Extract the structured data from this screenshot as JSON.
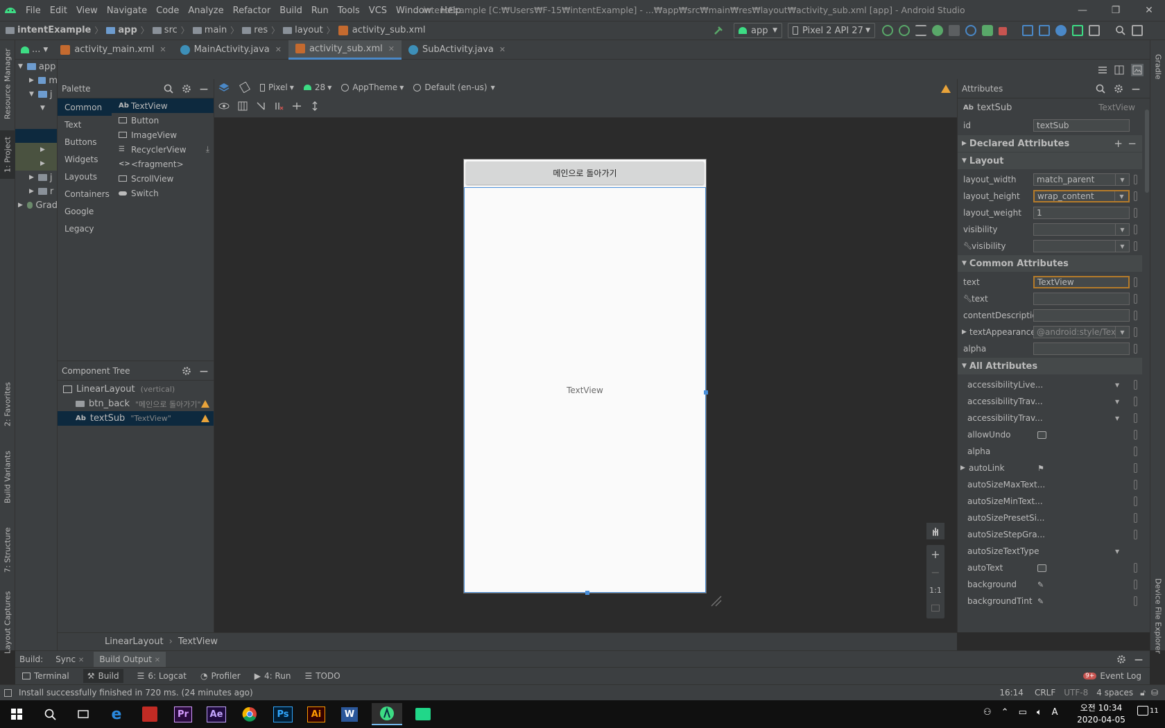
{
  "menubar": {
    "items": [
      "File",
      "Edit",
      "View",
      "Navigate",
      "Code",
      "Analyze",
      "Refactor",
      "Build",
      "Run",
      "Tools",
      "VCS",
      "Window",
      "Help"
    ],
    "title": "intentExample [C:₩Users₩F-15₩intentExample] - ...₩app₩src₩main₩res₩layout₩activity_sub.xml [app] - Android Studio",
    "minimize": "—",
    "restore": "❐",
    "close": "✕"
  },
  "navbar": {
    "crumbs": [
      "intentExample",
      "app",
      "src",
      "main",
      "res",
      "layout",
      "activity_sub.xml"
    ],
    "run_config": "app",
    "device": "Pixel 2 API 27"
  },
  "tabs": [
    {
      "label": "activity_main.xml",
      "type": "xml"
    },
    {
      "label": "MainActivity.java",
      "type": "java"
    },
    {
      "label": "activity_sub.xml",
      "type": "xml",
      "active": true
    },
    {
      "label": "SubActivity.java",
      "type": "java"
    }
  ],
  "tabs_overflow": "...",
  "left_strip": {
    "resource_manager": "Resource Manager",
    "project": "1: Project",
    "favorites": "2: Favorites",
    "build_variants": "Build Variants",
    "structure": "7: Structure",
    "layout_captures": "Layout Captures"
  },
  "right_strip": {
    "gradle": "Gradle",
    "device_file_explorer": "Device File Explorer"
  },
  "project_tree": {
    "root": "app",
    "items": [
      "m",
      "j",
      "",
      "",
      "j",
      "r",
      "Grad"
    ]
  },
  "design_toolbar": {
    "device": "Pixel",
    "api": "28",
    "theme": "AppTheme",
    "locale": "Default (en-us)"
  },
  "palette": {
    "title": "Palette",
    "categories": [
      "Common",
      "Text",
      "Buttons",
      "Widgets",
      "Layouts",
      "Containers",
      "Google",
      "Legacy"
    ],
    "selected_category": "Common",
    "items": [
      {
        "icon": "Ab",
        "label": "TextView"
      },
      {
        "icon": "btn",
        "label": "Button"
      },
      {
        "icon": "img",
        "label": "ImageView"
      },
      {
        "icon": "list",
        "label": "RecyclerView"
      },
      {
        "icon": "<>",
        "label": "<fragment>"
      },
      {
        "icon": "scroll",
        "label": "ScrollView"
      },
      {
        "icon": "switch",
        "label": "Switch"
      }
    ]
  },
  "component_tree": {
    "title": "Component Tree",
    "nodes": [
      {
        "label": "LinearLayout",
        "sub": "(vertical)"
      },
      {
        "label": "btn_back",
        "sub": "\"메인으로 돌아가기\""
      },
      {
        "label": "textSub",
        "sub": "\"TextView\""
      }
    ]
  },
  "device_preview": {
    "button_text": "메인으로 돌아가기",
    "textview_text": "TextView"
  },
  "zoom": {
    "one_to_one": "1:1",
    "plus": "+",
    "minus": "−"
  },
  "design_breadcrumb": [
    "LinearLayout",
    "TextView"
  ],
  "attributes": {
    "title": "Attributes",
    "widget_name": "textSub",
    "widget_type": "TextView",
    "id_label": "id",
    "id_value": "textSub",
    "declared_section": "Declared Attributes",
    "layout_section": "Layout",
    "layout": [
      {
        "name": "layout_width",
        "value": "match_parent",
        "dropdown": true
      },
      {
        "name": "layout_height",
        "value": "wrap_content",
        "dropdown": true,
        "focused": true
      },
      {
        "name": "layout_weight",
        "value": "1",
        "dropdown": false
      },
      {
        "name": "visibility",
        "value": "",
        "dropdown": true
      },
      {
        "name": "visibility",
        "value": "",
        "dropdown": true,
        "tool": true
      }
    ],
    "common_section": "Common Attributes",
    "common": [
      {
        "name": "text",
        "value": "TextView",
        "focused": true
      },
      {
        "name": "text",
        "value": "",
        "tool": true
      },
      {
        "name": "contentDescription",
        "value": ""
      },
      {
        "name": "textAppearance",
        "value": "@android:style/Tex",
        "dropdown": true,
        "expand": true
      },
      {
        "name": "alpha",
        "value": ""
      }
    ],
    "all_section": "All Attributes",
    "all": [
      "accessibilityLive...",
      "accessibilityTrav...",
      "accessibilityTrav...",
      "allowUndo",
      "alpha",
      "autoLink",
      "autoSizeMaxText...",
      "autoSizeMinText...",
      "autoSizePresetSi...",
      "autoSizeStepGra...",
      "autoSizeTextType",
      "autoText",
      "background",
      "backgroundTint"
    ]
  },
  "build_bar": {
    "label": "Build:",
    "sync": "Sync",
    "build_output": "Build Output"
  },
  "bottom_tools": [
    "Terminal",
    "Build",
    "6: Logcat",
    "Profiler",
    "4: Run",
    "TODO"
  ],
  "event_log": "Event Log",
  "event_log_badge": "9+",
  "status": {
    "message": "Install successfully finished in 720 ms. (24 minutes ago)",
    "position": "16:14",
    "line_sep": "CRLF",
    "encoding": "UTF-8",
    "indent": "4 spaces"
  },
  "taskbar": {
    "time": "오전 10:34",
    "date": "2020-04-05",
    "ime": "A",
    "notif_count": "11",
    "apps": [
      "Pr",
      "Ae",
      "Ps",
      "Ai",
      "W"
    ]
  }
}
